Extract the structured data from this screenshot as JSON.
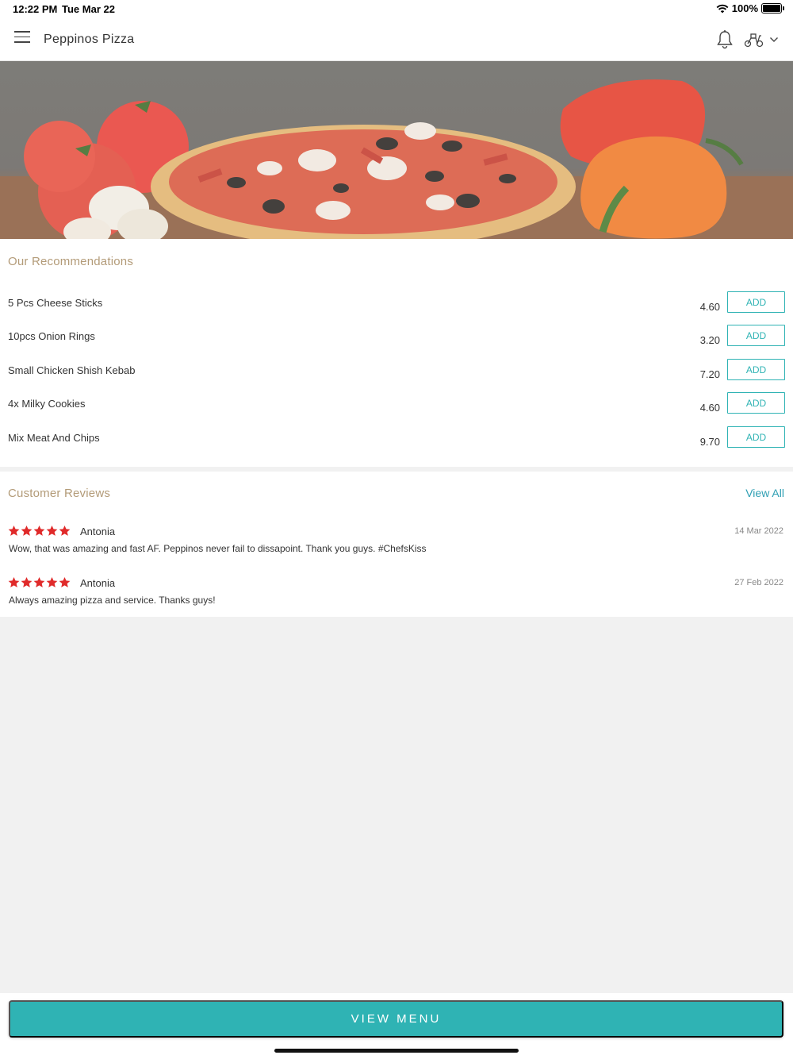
{
  "status_bar": {
    "time": "12:22 PM",
    "date": "Tue Mar 22",
    "battery": "100%"
  },
  "header": {
    "title": "Peppinos Pizza"
  },
  "recommendations": {
    "title": "Our Recommendations",
    "add_label": "ADD",
    "items": [
      {
        "name": "5 Pcs Cheese Sticks",
        "price": "4.60"
      },
      {
        "name": "10pcs Onion Rings",
        "price": "3.20"
      },
      {
        "name": "Small Chicken Shish Kebab",
        "price": "7.20"
      },
      {
        "name": "4x Milky Cookies",
        "price": "4.60"
      },
      {
        "name": "Mix Meat And Chips",
        "price": "9.70"
      }
    ]
  },
  "reviews": {
    "title": "Customer Reviews",
    "view_all": "View All",
    "items": [
      {
        "rating": 5,
        "name": "Antonia",
        "date": "14 Mar 2022",
        "text": "Wow, that was amazing and fast AF. Peppinos never fail to dissapoint. Thank you guys. #ChefsKiss"
      },
      {
        "rating": 5,
        "name": "Antonia",
        "date": "27 Feb 2022",
        "text": "Always amazing pizza and service. Thanks guys!"
      }
    ]
  },
  "footer": {
    "button_label": "VIEW MENU"
  },
  "colors": {
    "accent": "#2fb3b4",
    "section_title": "#b39b78",
    "star": "#e02a2a",
    "link": "#2f9fb3"
  }
}
